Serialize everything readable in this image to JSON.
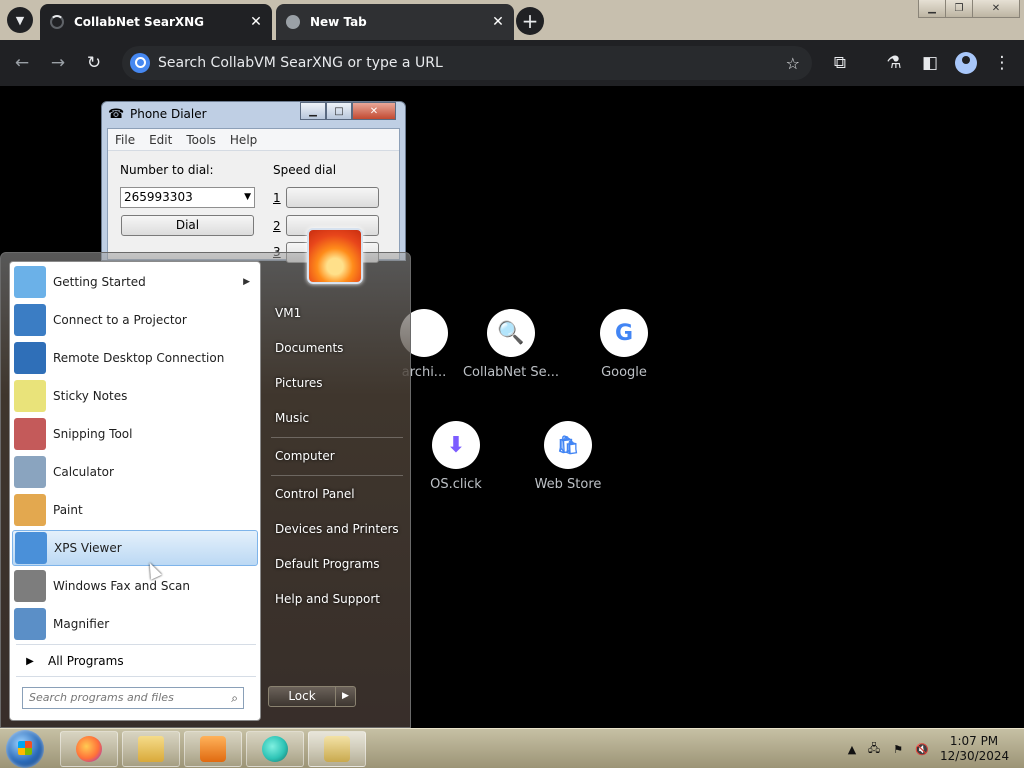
{
  "browser": {
    "tabs": [
      {
        "title": "CollabNet SearXNG",
        "active": true
      },
      {
        "title": "New Tab",
        "active": false
      }
    ],
    "close_glyph": "✕",
    "new_tab_glyph": "+",
    "omnibox_placeholder": "Search CollabVM SearXNG or type a URL"
  },
  "shortcuts": [
    {
      "label": "archi...",
      "glyph": "",
      "color": "#5f6368"
    },
    {
      "label": "CollabNet Se...",
      "glyph": "🔍",
      "color": "#1a73e8"
    },
    {
      "label": "Google",
      "glyph": "G",
      "color": "#4285f4"
    },
    {
      "label": "OS.click",
      "glyph": "⬇",
      "color": "#7c5cff"
    },
    {
      "label": "Web Store",
      "glyph": "🛍",
      "color": "#4285f4"
    }
  ],
  "dialer": {
    "title": "Phone Dialer",
    "menu": [
      "File",
      "Edit",
      "Tools",
      "Help"
    ],
    "number_label": "Number to dial:",
    "number_value": "265993303",
    "dial_label": "Dial",
    "speed_dial_label": "Speed dial",
    "speed_numbers": [
      "1",
      "2",
      "3"
    ]
  },
  "start_menu": {
    "programs": [
      {
        "label": "Getting Started",
        "has_submenu": true,
        "icon_color": "#6bb1e8"
      },
      {
        "label": "Connect to a Projector",
        "icon_color": "#3b7dc4"
      },
      {
        "label": "Remote Desktop Connection",
        "icon_color": "#2f6fb8"
      },
      {
        "label": "Sticky Notes",
        "icon_color": "#e9e37a"
      },
      {
        "label": "Snipping Tool",
        "icon_color": "#c45a5a"
      },
      {
        "label": "Calculator",
        "icon_color": "#8aa4bf"
      },
      {
        "label": "Paint",
        "icon_color": "#e3a84f"
      },
      {
        "label": "XPS Viewer",
        "selected": true,
        "icon_color": "#4a90d9"
      },
      {
        "label": "Windows Fax and Scan",
        "icon_color": "#7d7d7d"
      },
      {
        "label": "Magnifier",
        "icon_color": "#5b8fc7"
      }
    ],
    "all_programs": "All Programs",
    "search_placeholder": "Search programs and files",
    "right_items": [
      "VM1",
      "Documents",
      "Pictures",
      "Music",
      "Computer",
      "Control Panel",
      "Devices and Printers",
      "Default Programs",
      "Help and Support"
    ],
    "lock_label": "Lock"
  },
  "taskbar": {
    "apps": [
      {
        "name": "firefox",
        "color": "#ff7139"
      },
      {
        "name": "explorer",
        "color": "#e6c35c"
      },
      {
        "name": "media-player",
        "color": "#f08a24"
      },
      {
        "name": "collabvm",
        "color": "#2ec4b6"
      },
      {
        "name": "phone-dialer",
        "color": "#d9c27a"
      }
    ],
    "time": "1:07 PM",
    "date": "12/30/2024"
  }
}
